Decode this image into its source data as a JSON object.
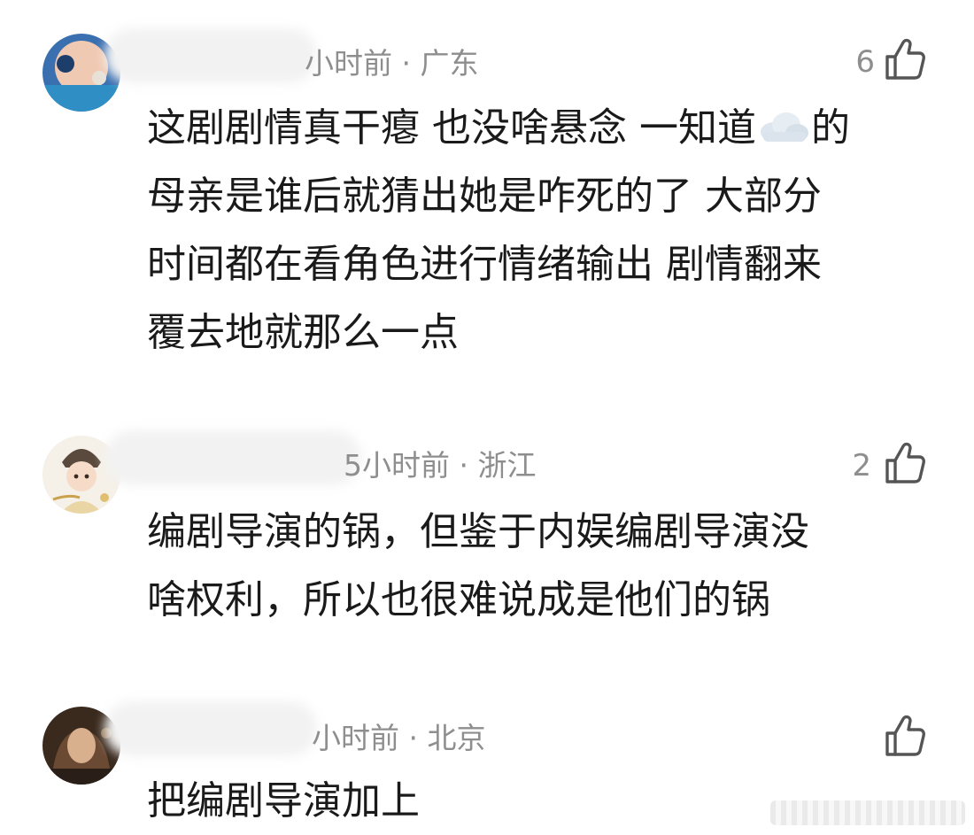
{
  "comments": [
    {
      "meta": "小时前 · 广东",
      "likes": "6",
      "lines": [
        {
          "before": "这剧剧情真干瘪 也没啥悬念 一知道",
          "emoji": "cloud-emoji",
          "after": "的"
        },
        "母亲是谁后就猜出她是咋死的了 大部分",
        "时间都在看角色进行情绪输出 剧情翻来",
        "覆去地就那么一点"
      ]
    },
    {
      "meta": "5小时前 · 浙江",
      "likes": "2",
      "lines": [
        "编剧导演的锅，但鉴于内娱编剧导演没",
        "啥权利，所以也很难说成是他们的锅"
      ]
    },
    {
      "meta": "小时前 · 北京",
      "likes": "",
      "lines": [
        "把编剧导演加上"
      ]
    }
  ],
  "colors": {
    "text": "#1a1a1a",
    "meta": "#8e8e8e",
    "background": "#ffffff"
  },
  "icons": {
    "like": "thumbs-up-icon",
    "emoji": "cloud-emoji"
  }
}
